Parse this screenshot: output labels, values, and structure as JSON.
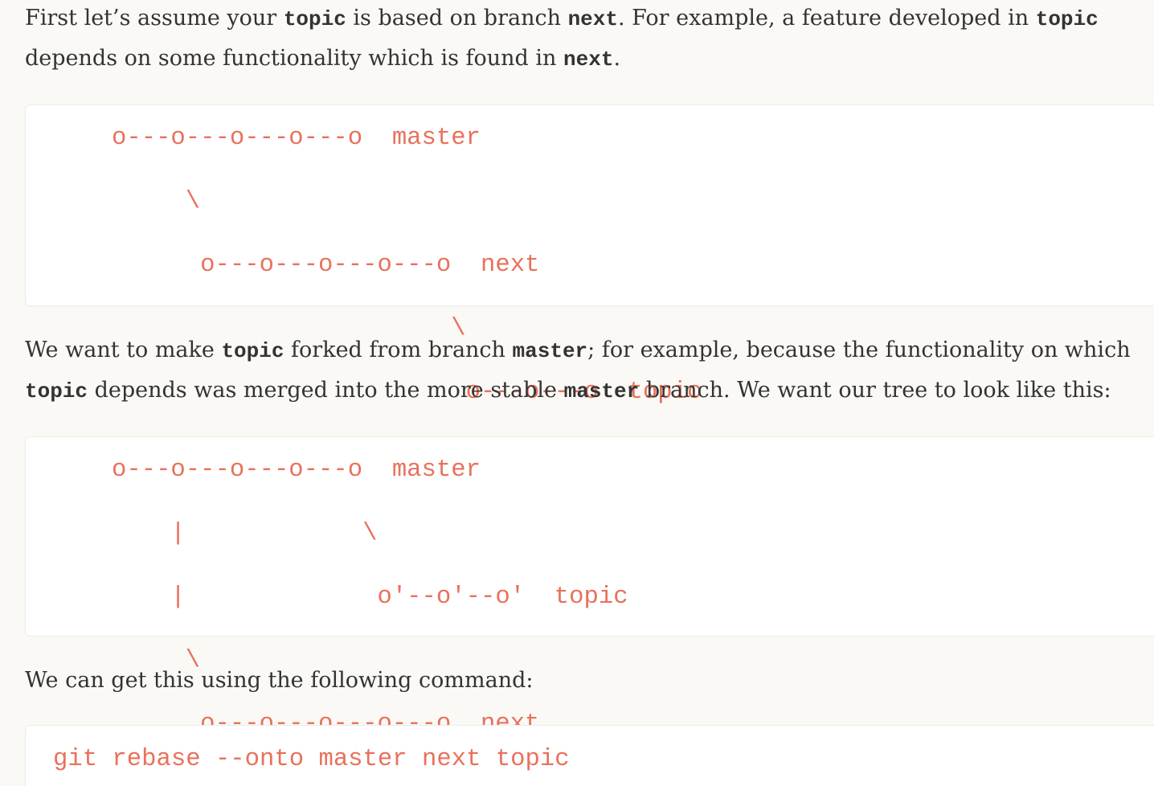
{
  "intro": {
    "l1_a": "First let’s assume your ",
    "l1_code1": "topic",
    "l1_b": " is based on branch ",
    "l1_code2": "next",
    "l1_c": ". For example, a feature developed in ",
    "l1_code3": "topic",
    "l2_a": "depends on some functionality which is found in ",
    "l2_code1": "next",
    "l2_b": "."
  },
  "diagram_before": {
    "line1": "o---o---o---o---o  master",
    "line2": "     \\",
    "line3": "      o---o---o---o---o  next",
    "line4": "                       \\",
    "line5": "                        o---o---o  topic"
  },
  "middle": {
    "l1_a": "We want to make ",
    "l1_code1": "topic",
    "l1_b": " forked from branch ",
    "l1_code2": "master",
    "l1_c": "; for example, because the functionality on which",
    "l2_code1": "topic",
    "l2_a": " depends was merged into the more stable ",
    "l2_code2": "master",
    "l2_b": " branch. We want our tree to look like this:"
  },
  "diagram_after": {
    "line1": "o---o---o---o---o  master",
    "line2": "    |            \\",
    "line3": "    |             o'--o'--o'  topic",
    "line4": "     \\",
    "line5": "      o---o---o---o---o  next"
  },
  "outro": {
    "text": "We can get this using the following command:"
  },
  "command": {
    "text": "git rebase --onto master next topic"
  },
  "colors": {
    "code_text": "#e8715c",
    "body_text": "#333333",
    "page_background": "#faf9f6",
    "code_background": "#ffffff"
  }
}
